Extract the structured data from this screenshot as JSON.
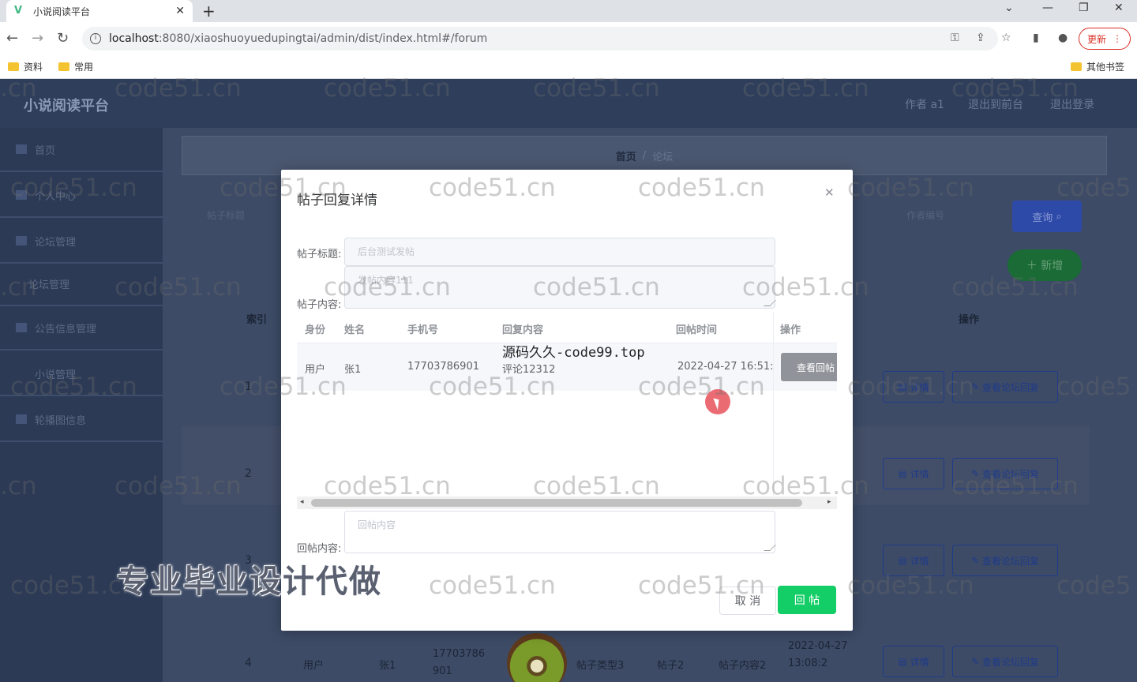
{
  "browser": {
    "tab_title": "小说阅读平台",
    "url_host": "localhost",
    "url_rest": ":8080/xiaoshuoyuedupingtai/admin/dist/index.html#/forum",
    "update_label": "更新",
    "bookmarks": [
      "资料",
      "常用"
    ],
    "other_bookmarks": "其他书签"
  },
  "app": {
    "logo": "小说阅读平台",
    "header_links": [
      "作者 a1",
      "退出到前台",
      "退出登录"
    ],
    "sidebar": [
      "首页",
      "个人中心",
      "论坛管理",
      "论坛管理",
      "公告信息管理",
      "小说管理",
      "轮播图信息"
    ],
    "breadcrumb": {
      "home": "首页",
      "sep": "/",
      "current": "论坛"
    },
    "search_label": "查询",
    "add_label": "新增",
    "search_fields": [
      "帖子标题",
      "作者编号"
    ],
    "table_headers": {
      "index": "索引",
      "ops": "操作"
    },
    "row_indices": [
      "1",
      "2",
      "3",
      "4"
    ],
    "row_buttons": {
      "detail": "详情",
      "view_reply": "查看论坛回复"
    },
    "row4": {
      "identity": "用户",
      "name": "张1",
      "phone": "17703786901",
      "type": "帖子类型3",
      "title": "帖子2",
      "content": "帖子内容2",
      "time": "2022-04-27 13:08:2"
    }
  },
  "modal": {
    "title": "帖子回复详情",
    "title_label": "帖子标题:",
    "title_value": "后台测试发帖",
    "content_label": "帖子内容:",
    "content_value": "发帖内容111",
    "reply_table": {
      "headers": [
        "身份",
        "姓名",
        "手机号",
        "回复内容",
        "回帖时间",
        "操作"
      ],
      "rows": [
        {
          "identity": "用户",
          "name": "张1",
          "phone": "17703786901",
          "content": "评论12312",
          "time": "2022-04-27 16:51:",
          "action": "查看回帖"
        }
      ]
    },
    "reply_label": "回帖内容:",
    "reply_placeholder": "回帖内容",
    "cancel_label": "取 消",
    "submit_label": "回 帖"
  },
  "watermarks": {
    "text": "code51.cn",
    "partial_left": ".cn",
    "partial_right": "code5",
    "overlay": "源码久久-code99.top",
    "promo": "专业毕业设计代做"
  }
}
